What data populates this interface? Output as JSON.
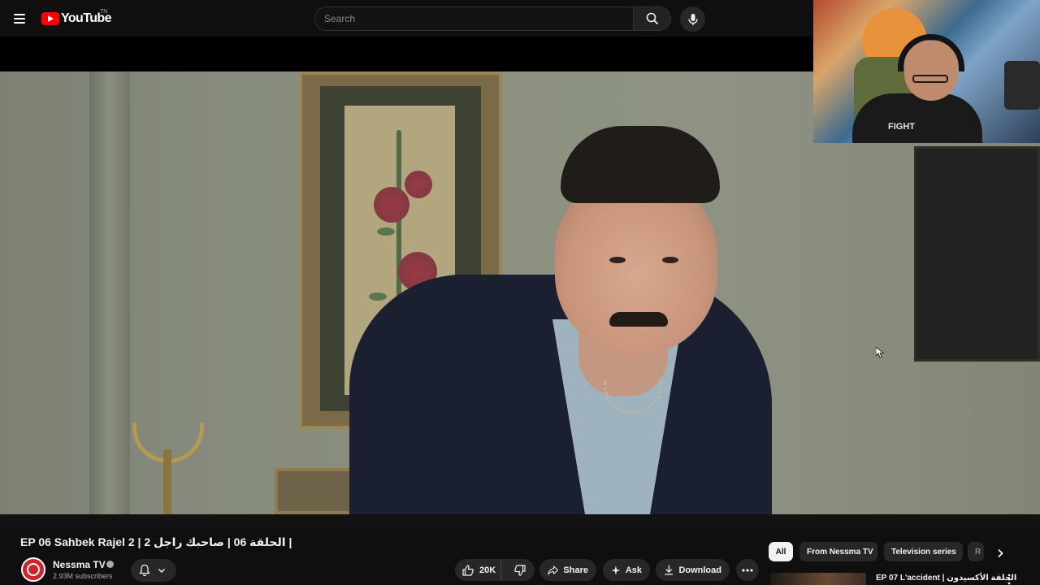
{
  "header": {
    "logo_text": "YouTube",
    "logo_superscript": "TN",
    "search_placeholder": "Search"
  },
  "video": {
    "title": "EP 06 Sahbek Rajel 2 | الحلقة 06 | صاحبك راجل 2 |",
    "webcam_shirt_text": "FIGHT"
  },
  "channel": {
    "name": "Nessma TV",
    "subscribers": "2.93M subscribers"
  },
  "actions": {
    "like_count": "20K",
    "share_label": "Share",
    "ask_label": "Ask",
    "download_label": "Download"
  },
  "chips": [
    "All",
    "From Nessma TV",
    "Television series",
    "R"
  ],
  "recommendation": {
    "title": "EP 07 L'accident | الحلقة الأكسيدون"
  },
  "colors": {
    "brand_red": "#ff0000",
    "background": "#0f0f0f",
    "button_bg": "#272727"
  }
}
